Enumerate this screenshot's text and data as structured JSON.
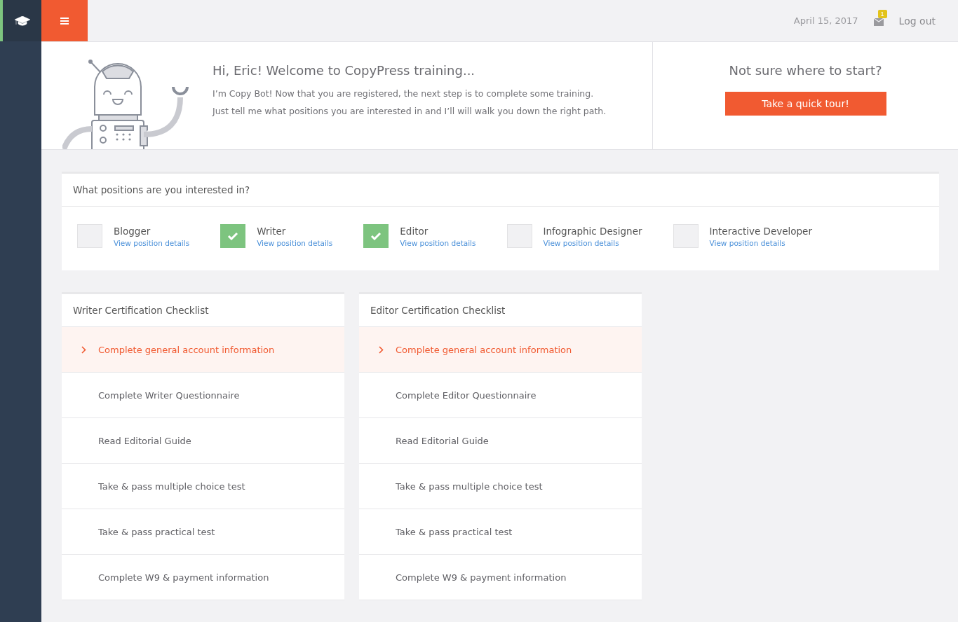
{
  "header": {
    "date": "April 15, 2017",
    "notifications": "1",
    "logout": "Log out"
  },
  "welcome": {
    "title": "Hi, Eric! Welcome to CopyPress training...",
    "lines": [
      "I’m Copy Bot! Now that you are registered, the next step is to complete some training.",
      "Just tell me what positions you are interested in and I’ll will walk you down the right path."
    ]
  },
  "tour": {
    "title": "Not sure where to start?",
    "button": "Take a quick tour!"
  },
  "positions": {
    "title": "What positions are you interested in?",
    "items": [
      {
        "label": "Blogger",
        "link": "View position details",
        "checked": false
      },
      {
        "label": "Writer",
        "link": "View position details",
        "checked": true
      },
      {
        "label": "Editor",
        "link": "View position details",
        "checked": true
      },
      {
        "label": "Infographic Designer",
        "link": "View position details",
        "checked": false
      },
      {
        "label": "Interactive Developer",
        "link": "View position details",
        "checked": false
      }
    ]
  },
  "checklists": [
    {
      "title": "Writer Certification Checklist",
      "items": [
        {
          "label": "Complete general account information",
          "selected": true
        },
        {
          "label": "Complete Writer Questionnaire",
          "selected": false
        },
        {
          "label": "Read Editorial Guide",
          "selected": false
        },
        {
          "label": "Take & pass multiple choice test",
          "selected": false
        },
        {
          "label": "Take & pass practical test",
          "selected": false
        },
        {
          "label": "Complete W9 & payment information",
          "selected": false
        }
      ]
    },
    {
      "title": "Editor Certification Checklist",
      "items": [
        {
          "label": "Complete general account information",
          "selected": true
        },
        {
          "label": "Complete Editor Questionnaire",
          "selected": false
        },
        {
          "label": "Read Editorial Guide",
          "selected": false
        },
        {
          "label": "Take & pass multiple choice test",
          "selected": false
        },
        {
          "label": "Take & pass practical test",
          "selected": false
        },
        {
          "label": "Complete W9 & payment information",
          "selected": false
        }
      ]
    }
  ]
}
